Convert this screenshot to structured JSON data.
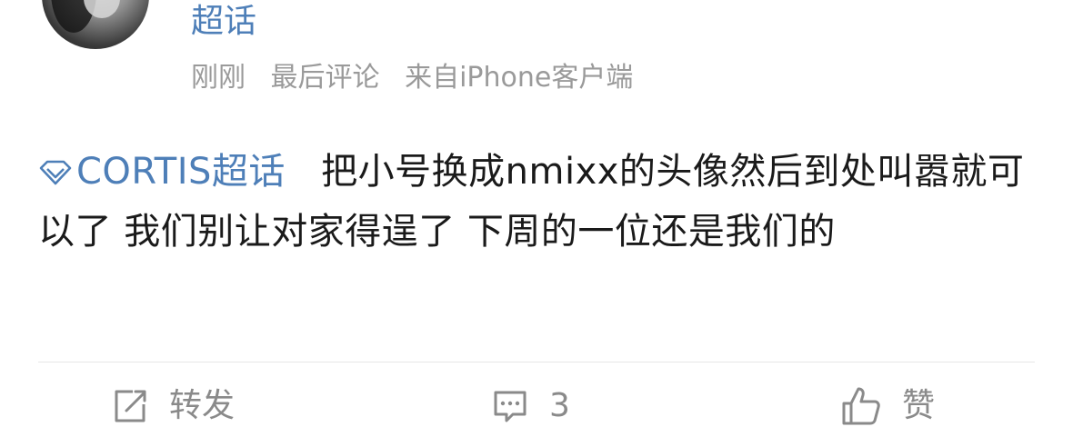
{
  "post": {
    "username": "超话",
    "meta": {
      "time": "刚刚",
      "last_comment": "最后评论",
      "source": "来自iPhone客户端"
    },
    "topic_label": "CORTIS超话",
    "body": "把小号换成nmixx的头像然后到处叫嚣就可以了 我们别让对家得逞了 下周的一位还是我们的"
  },
  "actions": {
    "repost": {
      "icon": "repost-icon",
      "label": "转发"
    },
    "comment": {
      "icon": "comment-icon",
      "count": "3"
    },
    "like": {
      "icon": "thumbs-up-icon",
      "label": "赞"
    }
  },
  "colors": {
    "link_blue": "#4e7fb8",
    "meta_gray": "#9a9a9a",
    "action_gray": "#8a8a8a",
    "body_text": "#1a1a1a",
    "divider": "#e6e6e6"
  }
}
